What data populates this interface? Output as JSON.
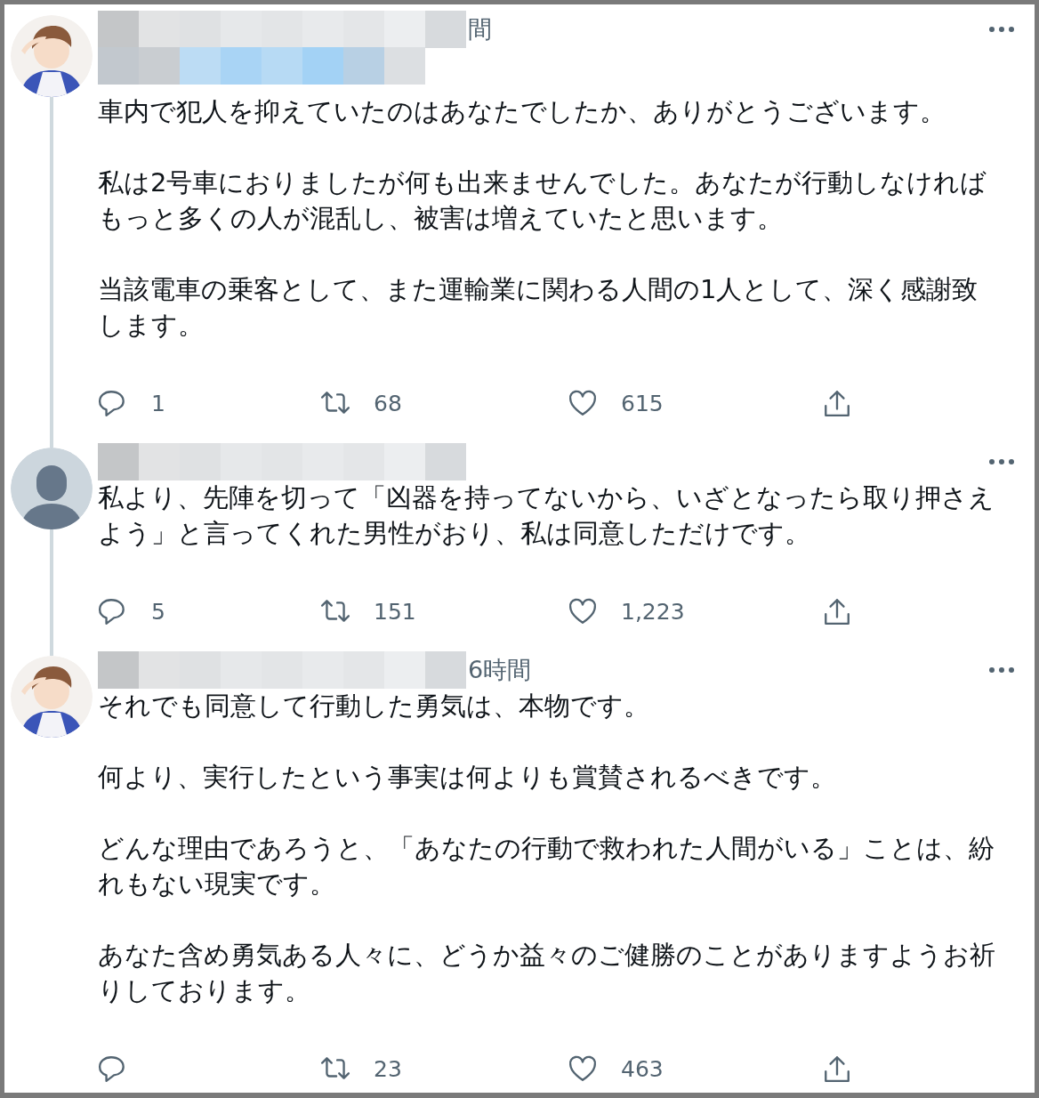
{
  "tweets": [
    {
      "avatar": {
        "kind": "illustration"
      },
      "handle_shown": true,
      "time": "間",
      "thread_above": false,
      "thread_below": true,
      "paragraphs": [
        "車内で犯人を抑えていたのはあなたでしたか、ありがとうございます。",
        "私は2号車におりましたが何も出来ませんでした。あなたが行動しなければもっと多くの人が混乱し、被害は増えていたと思います。",
        "当該電車の乗客として、また運輸業に関わる人間の1人として、深く感謝致します。"
      ],
      "replies": "1",
      "retweets": "68",
      "likes": "615"
    },
    {
      "avatar": {
        "kind": "default"
      },
      "handle_shown": false,
      "thread_above": true,
      "thread_below": true,
      "paragraphs": [
        "私より、先陣を切って「凶器を持ってないから、いざとなったら取り押さえよう」と言ってくれた男性がおり、私は同意しただけです。"
      ],
      "replies": "5",
      "retweets": "151",
      "likes": "1,223"
    },
    {
      "avatar": {
        "kind": "illustration"
      },
      "handle_shown": false,
      "time": "6時間",
      "thread_above": true,
      "thread_below": false,
      "paragraphs": [
        "それでも同意して行動した勇気は、本物です。",
        "何より、実行したという事実は何よりも賞賛されるべきです。",
        "どんな理由であろうと、「あなたの行動で救われた人間がいる」ことは、紛れもない現実です。",
        "あなた含め勇気ある人々に、どうか益々のご健勝のことがありますようお祈りしております。"
      ],
      "retweets": "23",
      "likes": "463"
    }
  ]
}
